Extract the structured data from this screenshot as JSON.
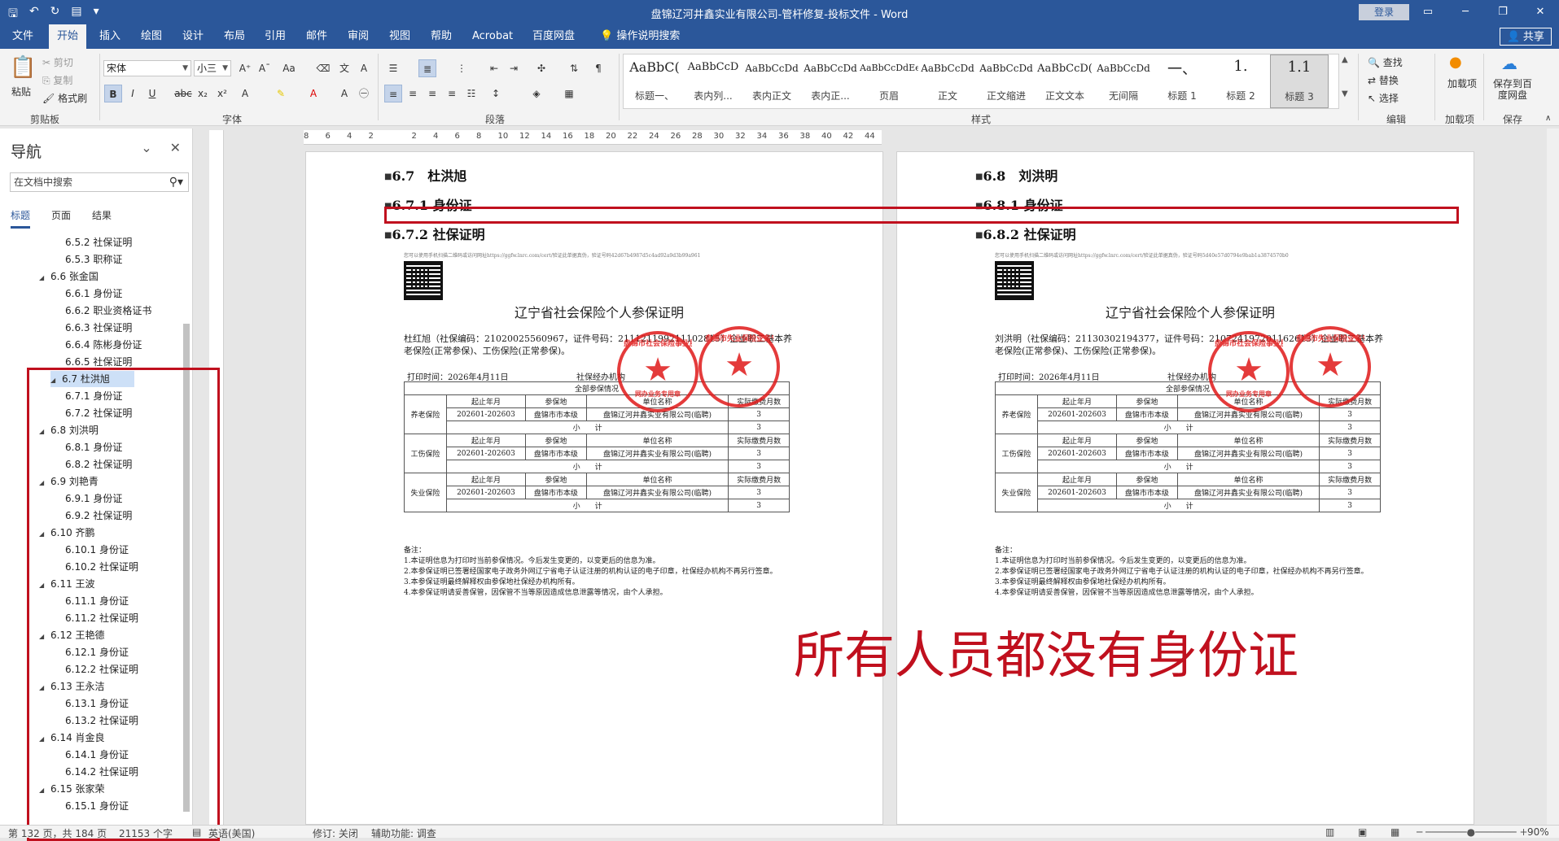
{
  "window": {
    "title": "盘锦辽河井鑫实业有限公司-管杆修复-投标文件  -  Word",
    "login_label": "登录",
    "share_label": "共享"
  },
  "tabs": [
    "文件",
    "开始",
    "插入",
    "绘图",
    "设计",
    "布局",
    "引用",
    "邮件",
    "审阅",
    "视图",
    "帮助",
    "Acrobat",
    "百度网盘",
    "操作说明搜索"
  ],
  "ribbon": {
    "clipboard": {
      "paste": "粘贴",
      "cut": "剪切",
      "copy": "复制",
      "format_painter": "格式刷",
      "label": "剪贴板"
    },
    "font": {
      "name": "宋体",
      "size": "小三",
      "label": "字体"
    },
    "paragraph": {
      "label": "段落"
    },
    "styles": {
      "label": "样式",
      "items": [
        {
          "preview": "AaBbC(",
          "name": "标题一、"
        },
        {
          "preview": "AaBbCcD",
          "name": "表内列..."
        },
        {
          "preview": "AaBbCcDd",
          "name": "表内正文"
        },
        {
          "preview": "AaBbCcDd",
          "name": "表内正..."
        },
        {
          "preview": "AaBbCcDdEe",
          "name": "页眉"
        },
        {
          "preview": "AaBbCcDd",
          "name": "正文"
        },
        {
          "preview": "AaBbCcDd",
          "name": "正文缩进"
        },
        {
          "preview": "AaBbCcD(",
          "name": "正文文本"
        },
        {
          "preview": "AaBbCcDd",
          "name": "无间隔"
        },
        {
          "preview": "一、",
          "name": "标题 1"
        },
        {
          "preview": "1.",
          "name": "标题 2"
        },
        {
          "preview": "1.1",
          "name": "标题 3"
        }
      ]
    },
    "editing": {
      "find": "查找",
      "replace": "替换",
      "select": "选择",
      "label": "编辑"
    },
    "addins": {
      "btn": "加载项",
      "label": "加载项"
    },
    "save": {
      "btn": "保存到百度网盘",
      "label": "保存"
    }
  },
  "nav": {
    "title": "导航",
    "search_placeholder": "在文档中搜索",
    "tabs": [
      "标题",
      "页面",
      "结果"
    ],
    "items": [
      {
        "text": "6.5.2 社保证明",
        "level": 2
      },
      {
        "text": "6.5.3 职称证",
        "level": 2
      },
      {
        "text": "6.6 张金国",
        "level": 1
      },
      {
        "text": "6.6.1 身份证",
        "level": 2
      },
      {
        "text": "6.6.2 职业资格证书",
        "level": 2
      },
      {
        "text": "6.6.3 社保证明",
        "level": 2
      },
      {
        "text": "6.6.4 陈彬身份证",
        "level": 2
      },
      {
        "text": "6.6.5 社保证明",
        "level": 2
      },
      {
        "text": "6.7 杜洪旭",
        "level": 1,
        "selected": true
      },
      {
        "text": "6.7.1 身份证",
        "level": 2
      },
      {
        "text": "6.7.2 社保证明",
        "level": 2
      },
      {
        "text": "6.8 刘洪明",
        "level": 1
      },
      {
        "text": "6.8.1 身份证",
        "level": 2
      },
      {
        "text": "6.8.2 社保证明",
        "level": 2
      },
      {
        "text": "6.9 刘艳青",
        "level": 1
      },
      {
        "text": "6.9.1 身份证",
        "level": 2
      },
      {
        "text": "6.9.2 社保证明",
        "level": 2
      },
      {
        "text": "6.10 齐鹏",
        "level": 1
      },
      {
        "text": "6.10.1 身份证",
        "level": 2
      },
      {
        "text": "6.10.2 社保证明",
        "level": 2
      },
      {
        "text": "6.11 王波",
        "level": 1
      },
      {
        "text": "6.11.1 身份证",
        "level": 2
      },
      {
        "text": "6.11.2 社保证明",
        "level": 2
      },
      {
        "text": "6.12 王艳德",
        "level": 1
      },
      {
        "text": "6.12.1 身份证",
        "level": 2
      },
      {
        "text": "6.12.2 社保证明",
        "level": 2
      },
      {
        "text": "6.13 王永洁",
        "level": 1
      },
      {
        "text": "6.13.1 身份证",
        "level": 2
      },
      {
        "text": "6.13.2 社保证明",
        "level": 2
      },
      {
        "text": "6.14 肖金良",
        "level": 1
      },
      {
        "text": "6.14.1 身份证",
        "level": 2
      },
      {
        "text": "6.14.2 社保证明",
        "level": 2
      },
      {
        "text": "6.15 张家荣",
        "level": 1
      },
      {
        "text": "6.15.1 身份证",
        "level": 2
      }
    ]
  },
  "ruler_numbers": [
    "8",
    "6",
    "4",
    "2",
    "",
    "2",
    "4",
    "6",
    "8",
    "10",
    "12",
    "14",
    "16",
    "18",
    "20",
    "22",
    "24",
    "26",
    "28",
    "30",
    "32",
    "34",
    "36",
    "38",
    "40",
    "42",
    "44"
  ],
  "pages": [
    {
      "h1": "6.7　杜洪旭",
      "h2": "6.7.1 身份证",
      "h3": "6.7.2 社保证明",
      "cert": {
        "verify": "您可以使用手机扫描二维码或访问网址https://ggfw.lnrc.com/cert/验证此单据真伪，验证号码42d67b4987d5c4ad92a9d3b99a961",
        "title": "辽宁省社会保险个人参保证明",
        "para": "杜红旭（社保编码：21020025560967，证件号码：211121199211102815）企业职工基本养老保险(正常参保)、工伤保险(正常参保)。",
        "print_time": "打印时间：2026年4月11日",
        "agency": "社保经办机构",
        "all_title": "全部参保情况",
        "sections": [
          {
            "name": "养老保险",
            "row": [
              "202601-202603",
              "盘锦市市本级",
              "盘锦辽河井鑫实业有限公司(临聘)",
              "3"
            ]
          },
          {
            "name": "工伤保险",
            "row": [
              "202601-202603",
              "盘锦市市本级",
              "盘锦辽河井鑫实业有限公司(临聘)",
              "3"
            ]
          },
          {
            "name": "失业保险",
            "row": [
              "202601-202603",
              "盘锦市市本级",
              "盘锦辽河井鑫实业有限公司(临聘)",
              "3"
            ]
          }
        ],
        "cols": [
          "起止年月",
          "参保地",
          "单位名称",
          "实际缴费月数"
        ],
        "subtotal": "小　　计",
        "subtotal_val": "3",
        "remarks": [
          "备注：",
          "1.本证明信息为打印时当前参保情况。今后发生变更的，以变更后的信息为准。",
          "2.本参保证明已签署经国家电子政务外网辽宁省电子认证注册的机构认证的电子印章，社保经办机构不再另行签章。",
          "3.本参保证明最终解释权由参保地社保经办机构所有。",
          "4.本参保证明请妥善保管，因保管不当等原因造成信息泄露等情况，由个人承担。"
        ],
        "seal1": "盘锦市社会保险事业服务中心",
        "seal1_sub": "网办业务专用章",
        "seal2": "盘锦市失业保险业务专用章"
      }
    },
    {
      "h1": "6.8　刘洪明",
      "h2": "6.8.1 身份证",
      "h3": "6.8.2 社保证明",
      "cert": {
        "verify": "您可以使用手机扫描二维码或访问网址https://ggfw.lnrc.com/cert/验证此单据真伪，验证号码5d40e57d0794e9bab1a3874570b0",
        "title": "辽宁省社会保险个人参保证明",
        "para": "刘洪明（社保编码：21130302194377，证件号码：210724197201162613）企业职工基本养老保险(正常参保)、工伤保险(正常参保)。",
        "print_time": "打印时间：2026年4月11日",
        "agency": "社保经办机构",
        "all_title": "全部参保情况",
        "sections": [
          {
            "name": "养老保险",
            "row": [
              "202601-202603",
              "盘锦市市本级",
              "盘锦辽河井鑫实业有限公司(临聘)",
              "3"
            ]
          },
          {
            "name": "工伤保险",
            "row": [
              "202601-202603",
              "盘锦市市本级",
              "盘锦辽河井鑫实业有限公司(临聘)",
              "3"
            ]
          },
          {
            "name": "失业保险",
            "row": [
              "202601-202603",
              "盘锦市市本级",
              "盘锦辽河井鑫实业有限公司(临聘)",
              "3"
            ]
          }
        ],
        "cols": [
          "起止年月",
          "参保地",
          "单位名称",
          "实际缴费月数"
        ],
        "subtotal": "小　　计",
        "subtotal_val": "3",
        "remarks": [
          "备注：",
          "1.本证明信息为打印时当前参保情况。今后发生变更的，以变更后的信息为准。",
          "2.本参保证明已签署经国家电子政务外网辽宁省电子认证注册的机构认证的电子印章，社保经办机构不再另行签章。",
          "3.本参保证明最终解释权由参保地社保经办机构所有。",
          "4.本参保证明请妥善保管，因保管不当等原因造成信息泄露等情况，由个人承担。"
        ],
        "seal1": "盘锦市社会保险事业服务中心",
        "seal1_sub": "网办业务专用章",
        "seal2": "盘锦市失业保险业务专用章"
      }
    }
  ],
  "annotation_text": "所有人员都没有身份证",
  "status": {
    "page": "第 132 页，共 184 页",
    "words": "21153 个字",
    "lang": "英语(美国)",
    "track": "修订: 关闭",
    "access": "辅助功能: 调查",
    "zoom": "90%"
  },
  "colors": {
    "word_blue": "#2b579a",
    "annot_red": "#c0101e",
    "seal_red": "#e01a1a"
  }
}
